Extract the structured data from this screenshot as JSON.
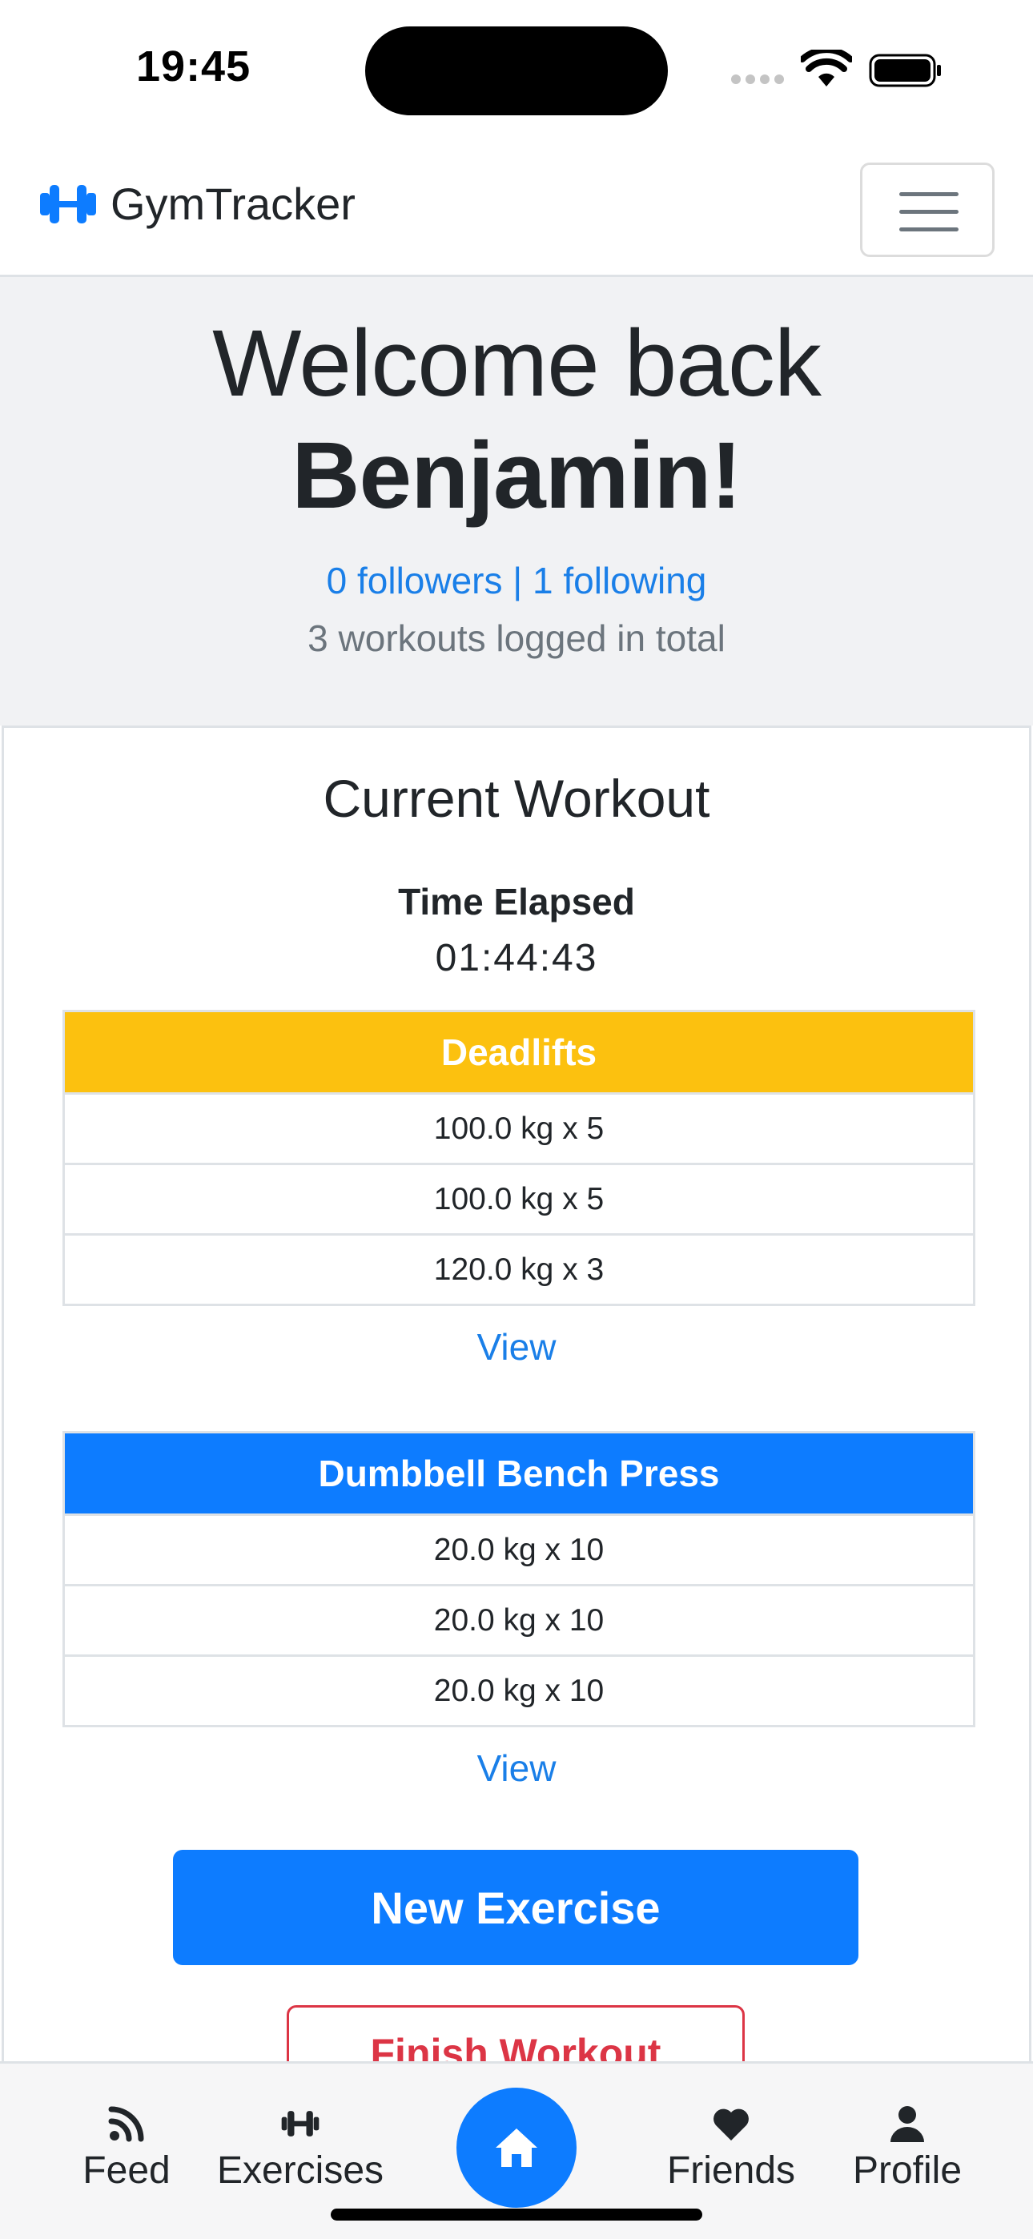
{
  "status_bar": {
    "time": "19:45"
  },
  "navbar": {
    "brand_name": "GymTracker",
    "brand_color": "#0d7cff"
  },
  "hero": {
    "greeting": "Welcome back",
    "user_name": "Benjamin!",
    "followers": "0 followers",
    "separator": " | ",
    "following": "1 following",
    "workouts_total": "3 workouts logged in total"
  },
  "workout": {
    "title": "Current Workout",
    "elapsed_label": "Time Elapsed",
    "elapsed_time": "01:44:43",
    "exercises": [
      {
        "name": "Deadlifts",
        "header_color": "#fcc10f",
        "sets": [
          "100.0 kg x 5",
          "100.0 kg x 5",
          "120.0 kg x 3"
        ],
        "view_label": "View"
      },
      {
        "name": "Dumbbell Bench Press",
        "header_color": "#0d7cff",
        "sets": [
          "20.0 kg x 10",
          "20.0 kg x 10",
          "20.0 kg x 10"
        ],
        "view_label": "View"
      }
    ],
    "new_exercise_label": "New Exercise",
    "finish_workout_label": "Finish Workout"
  },
  "bottom_nav": {
    "items": [
      {
        "label": "Feed",
        "icon": "rss-icon"
      },
      {
        "label": "Exercises",
        "icon": "dumbbell-icon"
      },
      {
        "label": "",
        "icon": "home-icon"
      },
      {
        "label": "Friends",
        "icon": "heart-icon"
      },
      {
        "label": "Profile",
        "icon": "person-icon"
      }
    ]
  }
}
